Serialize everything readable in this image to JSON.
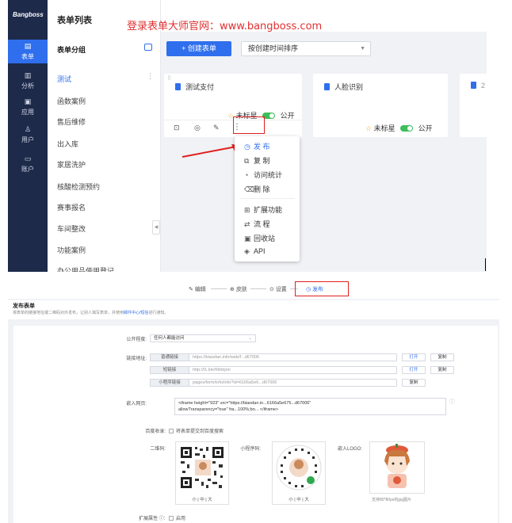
{
  "top": {
    "logo": "Bangboss",
    "page_title": "表单列表",
    "watermark": "登录表单大师官网：www.bangboss.com",
    "nav": [
      {
        "label": "表单",
        "icon": "form-icon",
        "active": true
      },
      {
        "label": "分析",
        "icon": "chart-icon"
      },
      {
        "label": "应用",
        "icon": "app-icon"
      },
      {
        "label": "用户",
        "icon": "user-icon"
      },
      {
        "label": "账户",
        "icon": "wallet-icon"
      }
    ],
    "group": {
      "heading": "表单分组",
      "items": [
        "测试",
        "函数案例",
        "售后维修",
        "出入库",
        "家居洗护",
        "核酸检测预约",
        "赛事报名",
        "车间整改",
        "功能案例",
        "办公用品使用登记"
      ]
    },
    "toolbar": {
      "create_label": "+ 创建表单",
      "sort_value": "按创建时间排序"
    },
    "cards": [
      {
        "name": "测试支付",
        "star": "未标星",
        "public": "公开"
      },
      {
        "name": "人脸识别",
        "star": "未标星",
        "public": "公开"
      },
      {
        "name": "2"
      }
    ],
    "menu": [
      "发 布",
      "复 制",
      "访问统计",
      "删 除",
      "扩展功能",
      "流 程",
      "回收站",
      "API"
    ]
  },
  "bottom": {
    "steps": [
      "编辑",
      "皮肤",
      "设置",
      "发布"
    ],
    "title": "发布表单",
    "desc": "将表单的链接地址或二维码对外发布，让别人填写表单，并使用",
    "desc_link": "邮件中心/短信",
    "desc_tail": "进行通知。",
    "public_level_label": "公开程度:",
    "public_level_value": "任何人都能访问",
    "link_label": "链接地址:",
    "links": [
      {
        "tag": "普通链接",
        "url": "https://biaodan.info/web/f...d67006",
        "buttons": [
          "打开",
          "复制"
        ]
      },
      {
        "tag": "短链接",
        "url": "http://t1.lnk/f/khbjnn",
        "buttons": [
          "打开",
          "复制"
        ]
      },
      {
        "tag": "小程序链接",
        "url": "pages/form/info/info?id=6166a5e6...d67006",
        "buttons": [
          "复制"
        ]
      }
    ],
    "embed_label": "嵌入网页:",
    "embed_code_1": "<iframe height=\"923\" src=\"https://biaodan.in...6166a5e675...d67006\"",
    "embed_code_2": "allowTransparency=\"true\" fra...100%;bo...        </iframe>",
    "baidu_label": "百度收录:",
    "baidu_text": "将表单提交到百度搜索",
    "qr_label": "二维码:",
    "mini_label": "小程序码:",
    "logo_label": "嵌入LOGO:",
    "sizes": [
      "小",
      "中",
      "大"
    ],
    "logo_hint": "支持80*80px的jpg图片",
    "ext_label": "扩展属性",
    "ext_text": "启用"
  }
}
